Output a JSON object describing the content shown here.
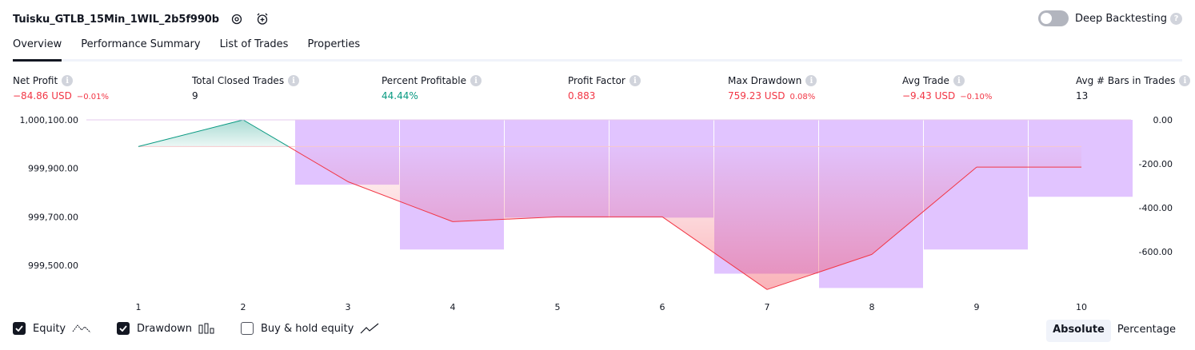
{
  "header": {
    "strategy_name": "Tuisku_GTLB_15Min_1WIL_2b5f990b",
    "deep_backtesting_label": "Deep Backtesting"
  },
  "tabs": [
    {
      "label": "Overview",
      "active": true
    },
    {
      "label": "Performance Summary",
      "active": false
    },
    {
      "label": "List of Trades",
      "active": false
    },
    {
      "label": "Properties",
      "active": false
    }
  ],
  "metrics": {
    "net_profit": {
      "label": "Net Profit",
      "value": "−84.86 USD",
      "pct": "−0.01%"
    },
    "total_closed_trades": {
      "label": "Total Closed Trades",
      "value": "9"
    },
    "percent_profitable": {
      "label": "Percent Profitable",
      "value": "44.44%"
    },
    "profit_factor": {
      "label": "Profit Factor",
      "value": "0.883"
    },
    "max_drawdown": {
      "label": "Max Drawdown",
      "value": "759.23 USD",
      "pct": "0.08%"
    },
    "avg_trade": {
      "label": "Avg Trade",
      "value": "−9.43 USD",
      "pct": "−0.10%"
    },
    "avg_bars": {
      "label": "Avg # Bars in Trades",
      "value": "13"
    }
  },
  "colors": {
    "equity_up": "#089981",
    "equity_down": "#f23645",
    "drawdown_bar": "#e1c4ff",
    "accent_dark": "#131722"
  },
  "chart_data": {
    "type": "line",
    "x": [
      1,
      2,
      3,
      4,
      5,
      6,
      7,
      8,
      9,
      10
    ],
    "series": [
      {
        "name": "Equity",
        "axis": "left",
        "values": [
          999990,
          1000100,
          999845,
          999680,
          999700,
          999700,
          999400,
          999545,
          999905,
          999905
        ]
      },
      {
        "name": "Drawdown",
        "axis": "right",
        "type": "bar",
        "values": [
          null,
          null,
          -295,
          -590,
          -445,
          -445,
          -700,
          -765,
          -590,
          -350
        ]
      }
    ],
    "baseline": 999990,
    "left_ticks": [
      "1,000,100.00",
      "999,900.00",
      "999,700.00",
      "999,500.00"
    ],
    "left_tick_values": [
      1000100,
      999900,
      999700,
      999500
    ],
    "right_ticks": [
      "0.00",
      "-200.00",
      "-400.00",
      "-600.00"
    ],
    "right_tick_values": [
      0,
      -200,
      -400,
      -600
    ],
    "x_ticks": [
      "1",
      "2",
      "3",
      "4",
      "5",
      "6",
      "7",
      "8",
      "9",
      "10"
    ]
  },
  "legend": [
    {
      "label": "Equity",
      "checked": true
    },
    {
      "label": "Drawdown",
      "checked": true
    },
    {
      "label": "Buy & hold equity",
      "checked": false
    }
  ],
  "modes": [
    {
      "label": "Absolute",
      "selected": true
    },
    {
      "label": "Percentage",
      "selected": false
    }
  ]
}
